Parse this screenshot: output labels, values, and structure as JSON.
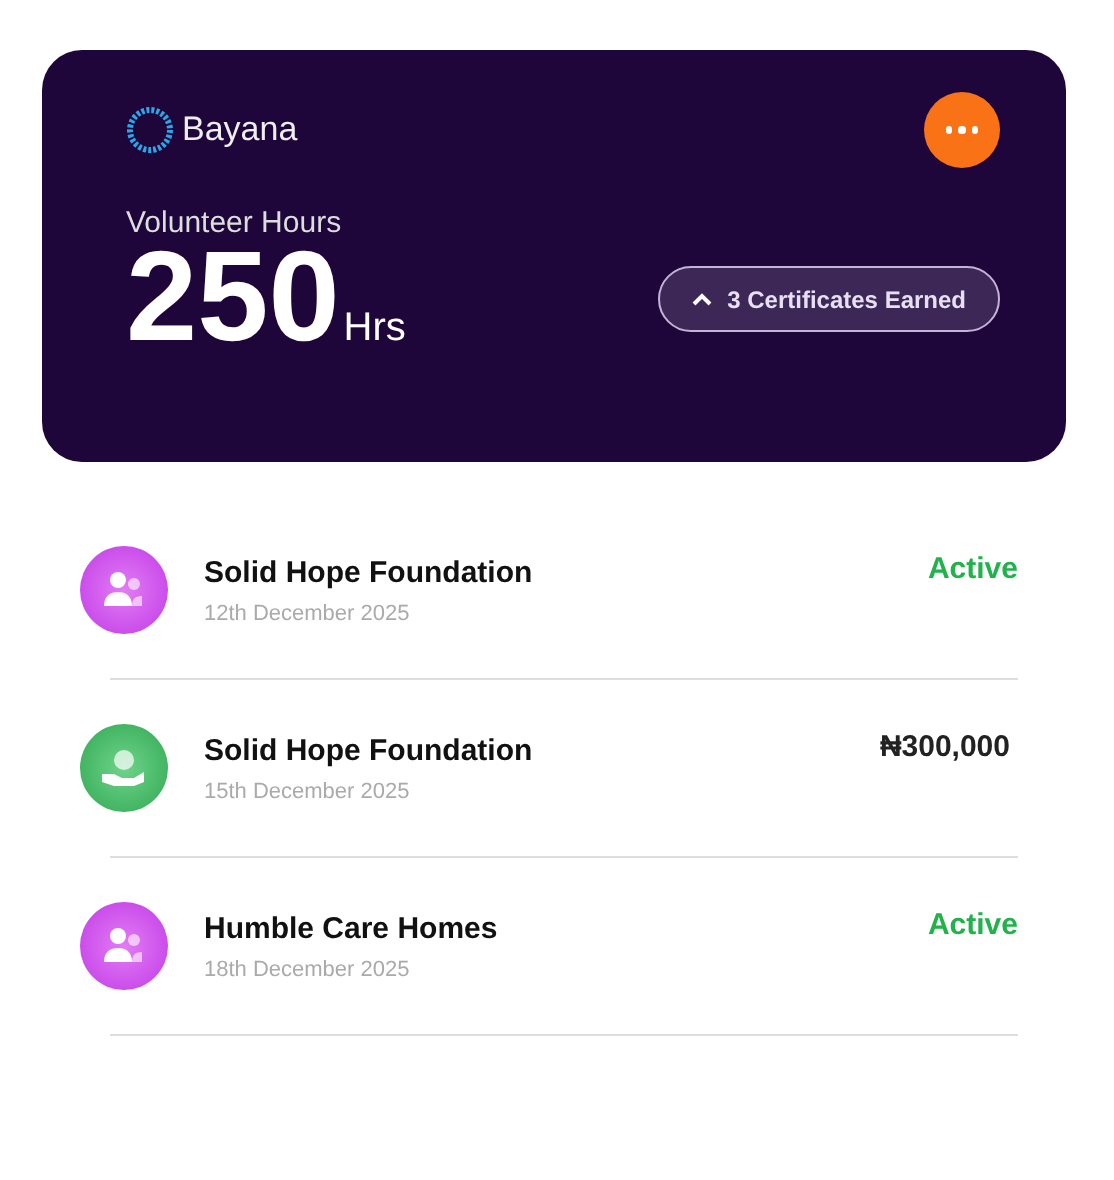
{
  "card": {
    "brand": "Bayana",
    "label": "Volunteer Hours",
    "value": "250",
    "unit": "Hrs",
    "badge": "3 Certificates Earned"
  },
  "items": [
    {
      "kind": "volunteer",
      "title": "Solid Hope Foundation",
      "date": "12th December 2025",
      "status": "Active"
    },
    {
      "kind": "donation",
      "title": "Solid Hope Foundation",
      "date": "15th December 2025",
      "status": "₦300,000"
    },
    {
      "kind": "volunteer",
      "title": "Humble Care Homes",
      "date": "18th December 2025",
      "status": "Active"
    }
  ]
}
